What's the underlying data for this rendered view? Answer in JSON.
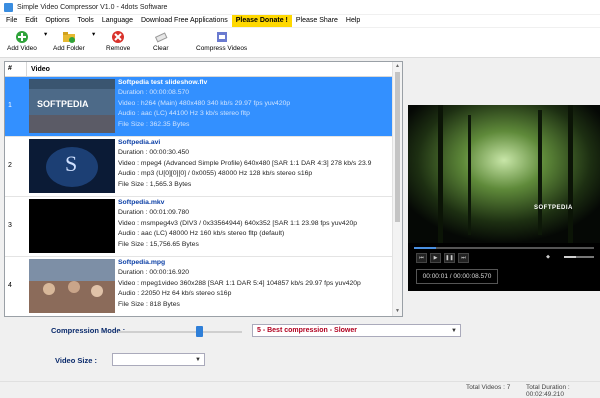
{
  "window": {
    "title": "Simple Video Compressor V1.0 - 4dots Software"
  },
  "menu": [
    "File",
    "Edit",
    "Options",
    "Tools",
    "Language",
    "Download Free Applications",
    "Please Donate !",
    "Please Share",
    "Help"
  ],
  "toolbar": {
    "add_video": "Add Video",
    "add_folder": "Add Folder",
    "remove": "Remove",
    "clear": "Clear",
    "compress": "Compress Videos"
  },
  "list": {
    "col_num": "#",
    "col_video": "Video",
    "rows": [
      {
        "num": "1",
        "name": "Softpedia test slideshow.flv",
        "duration": "Duration : 00:00:08.570",
        "video": "Video : h264 (Main) 480x480 340 kb/s 29.97 fps yuv420p",
        "audio": "Audio : aac (LC) 44100 Hz 3 kb/s stereo fltp",
        "size": "File Size : 362.35 Bytes",
        "thumb_text": "SOFTPEDIA"
      },
      {
        "num": "2",
        "name": "Softpedia.avi",
        "duration": "Duration : 00:00:30.450",
        "video": "Video : mpeg4 (Advanced Simple Profile) 640x480 [SAR 1:1 DAR 4:3] 278 kb/s 23.9",
        "audio": "Audio : mp3 (U[0][0][0] / 0x0055) 48000 Hz 128 kb/s stereo s16p",
        "size": "File Size : 1,565.3 Bytes",
        "thumb_text": "S"
      },
      {
        "num": "3",
        "name": "Softpedia.mkv",
        "duration": "Duration : 00:01:09.780",
        "video": "Video : msmpeg4v3 (DIV3 / 0x33564944) 640x352 [SAR 1:1 23.98 fps yuv420p",
        "audio": "Audio : aac (LC) 48000 Hz 160 kb/s stereo fltp (default)",
        "size": "File Size : 15,756.65 Bytes",
        "thumb_text": ""
      },
      {
        "num": "4",
        "name": "Softpedia.mpg",
        "duration": "Duration : 00:00:16.920",
        "video": "Video : mpeg1video 360x288 [SAR 1:1 DAR 5:4] 104857 kb/s 29.97 fps yuv420p",
        "audio": "Audio : 22050 Hz 64 kb/s stereo s16p",
        "size": "File Size : 818 Bytes",
        "thumb_text": ""
      }
    ]
  },
  "player": {
    "watermark": "SOFTPEDIA",
    "time": "00:00:01 / 00:00:08.570",
    "progress_fraction": 0.12,
    "volume_fraction": 0.4
  },
  "compression": {
    "label": "Compression Mode :",
    "selected": "5 - Best compression - Slower",
    "slider_fraction": 0.65
  },
  "video_size": {
    "label": "Video Size :",
    "selected": ""
  },
  "status": {
    "total_videos": "Total Videos : 7",
    "total_duration": "Total Duration : 00:02:49.210"
  },
  "colors": {
    "selection": "#3390ff",
    "donate": "#ffd800",
    "accent_label": "#0a2a6b",
    "select_value": "#b00020"
  }
}
